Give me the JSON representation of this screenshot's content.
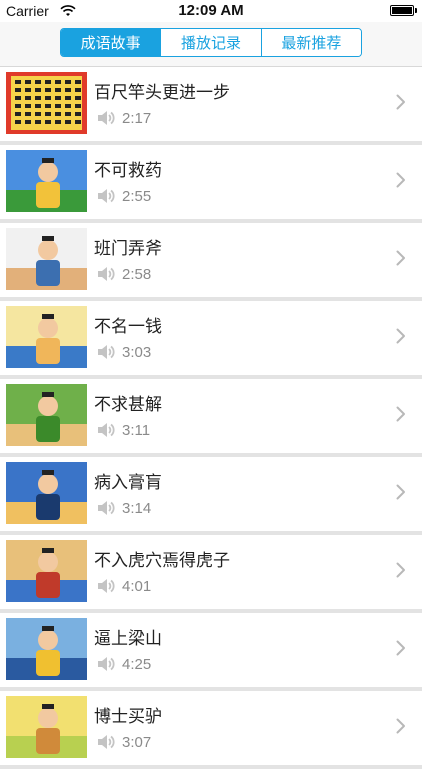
{
  "status": {
    "carrier": "Carrier",
    "time": "12:09 AM"
  },
  "tabs": [
    {
      "label": "成语故事",
      "active": true
    },
    {
      "label": "播放记录",
      "active": false
    },
    {
      "label": "最新推荐",
      "active": false
    }
  ],
  "colors": {
    "accent": "#1aa2e0",
    "duration_text": "#8a8a8a",
    "separator": "#e3e3e3"
  },
  "items": [
    {
      "title": "百尺竿头更进一步",
      "duration": "2:17",
      "thumb_icon": "calligraphy-scroll-thumbnail"
    },
    {
      "title": "不可救药",
      "duration": "2:55",
      "thumb_icon": "cartoon-thumbnail"
    },
    {
      "title": "班门弄斧",
      "duration": "2:58",
      "thumb_icon": "cartoon-thumbnail"
    },
    {
      "title": "不名一钱",
      "duration": "3:03",
      "thumb_icon": "cartoon-thumbnail"
    },
    {
      "title": "不求甚解",
      "duration": "3:11",
      "thumb_icon": "cartoon-thumbnail"
    },
    {
      "title": "病入膏肓",
      "duration": "3:14",
      "thumb_icon": "cartoon-thumbnail"
    },
    {
      "title": "不入虎穴焉得虎子",
      "duration": "4:01",
      "thumb_icon": "cartoon-thumbnail"
    },
    {
      "title": "逼上梁山",
      "duration": "4:25",
      "thumb_icon": "cartoon-thumbnail"
    },
    {
      "title": "博士买驴",
      "duration": "3:07",
      "thumb_icon": "cartoon-thumbnail"
    }
  ]
}
